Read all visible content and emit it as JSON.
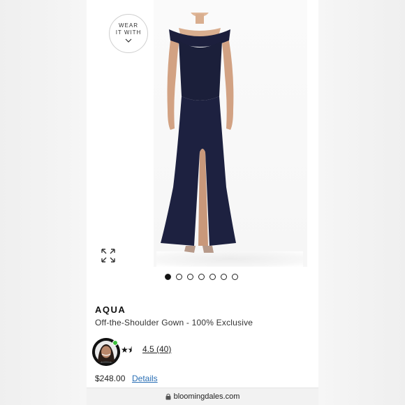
{
  "badge": {
    "line1": "WEAR",
    "line2": "IT WITH"
  },
  "carousel": {
    "count": 7,
    "active": 0
  },
  "product": {
    "brand": "AQUA",
    "name": "Off-the-Shoulder Gown - 100% Exclusive",
    "stars": "★⯨",
    "rating": "4.5 (40)",
    "price": "$248.00",
    "details_label": "Details"
  },
  "browser": {
    "url": "bloomingdales.com"
  },
  "colors": {
    "dress": "#1b1f3a",
    "link": "#2a6fb5",
    "online": "#3cc13b"
  },
  "icons": [
    "expand-icon",
    "chevron-down-icon",
    "lock-icon",
    "star-icon"
  ]
}
